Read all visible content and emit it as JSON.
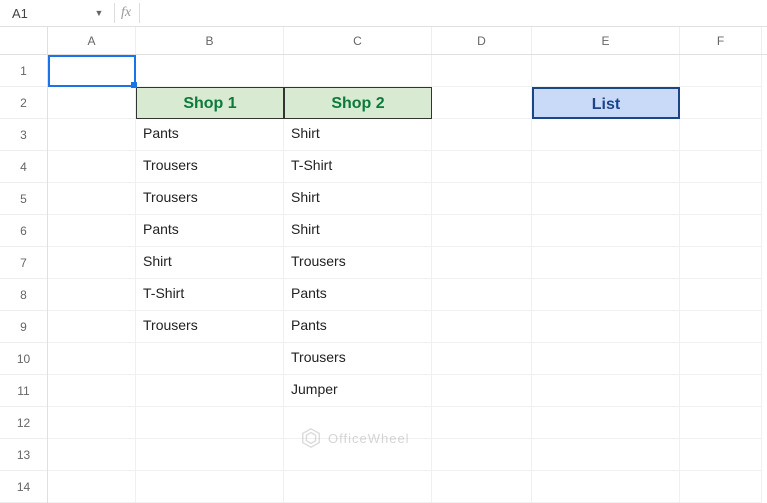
{
  "name_box": {
    "value": "A1"
  },
  "formula_bar": {
    "fx_label": "fx",
    "value": ""
  },
  "columns": [
    "A",
    "B",
    "C",
    "D",
    "E",
    "F"
  ],
  "rows": [
    "1",
    "2",
    "3",
    "4",
    "5",
    "6",
    "7",
    "8",
    "9",
    "10",
    "11",
    "12",
    "13",
    "14"
  ],
  "headers": {
    "shop1": "Shop 1",
    "shop2": "Shop 2",
    "list": "List"
  },
  "chart_data": {
    "type": "table",
    "columns": [
      "Shop 1",
      "Shop 2"
    ],
    "shop1": [
      "Pants",
      "Trousers",
      "Trousers",
      "Pants",
      "Shirt",
      "T-Shirt",
      "Trousers"
    ],
    "shop2": [
      "Shirt",
      "T-Shirt",
      "Shirt",
      "Shirt",
      "Trousers",
      "Pants",
      "Pants",
      "Trousers",
      "Jumper"
    ]
  },
  "watermark": "OfficeWheel"
}
